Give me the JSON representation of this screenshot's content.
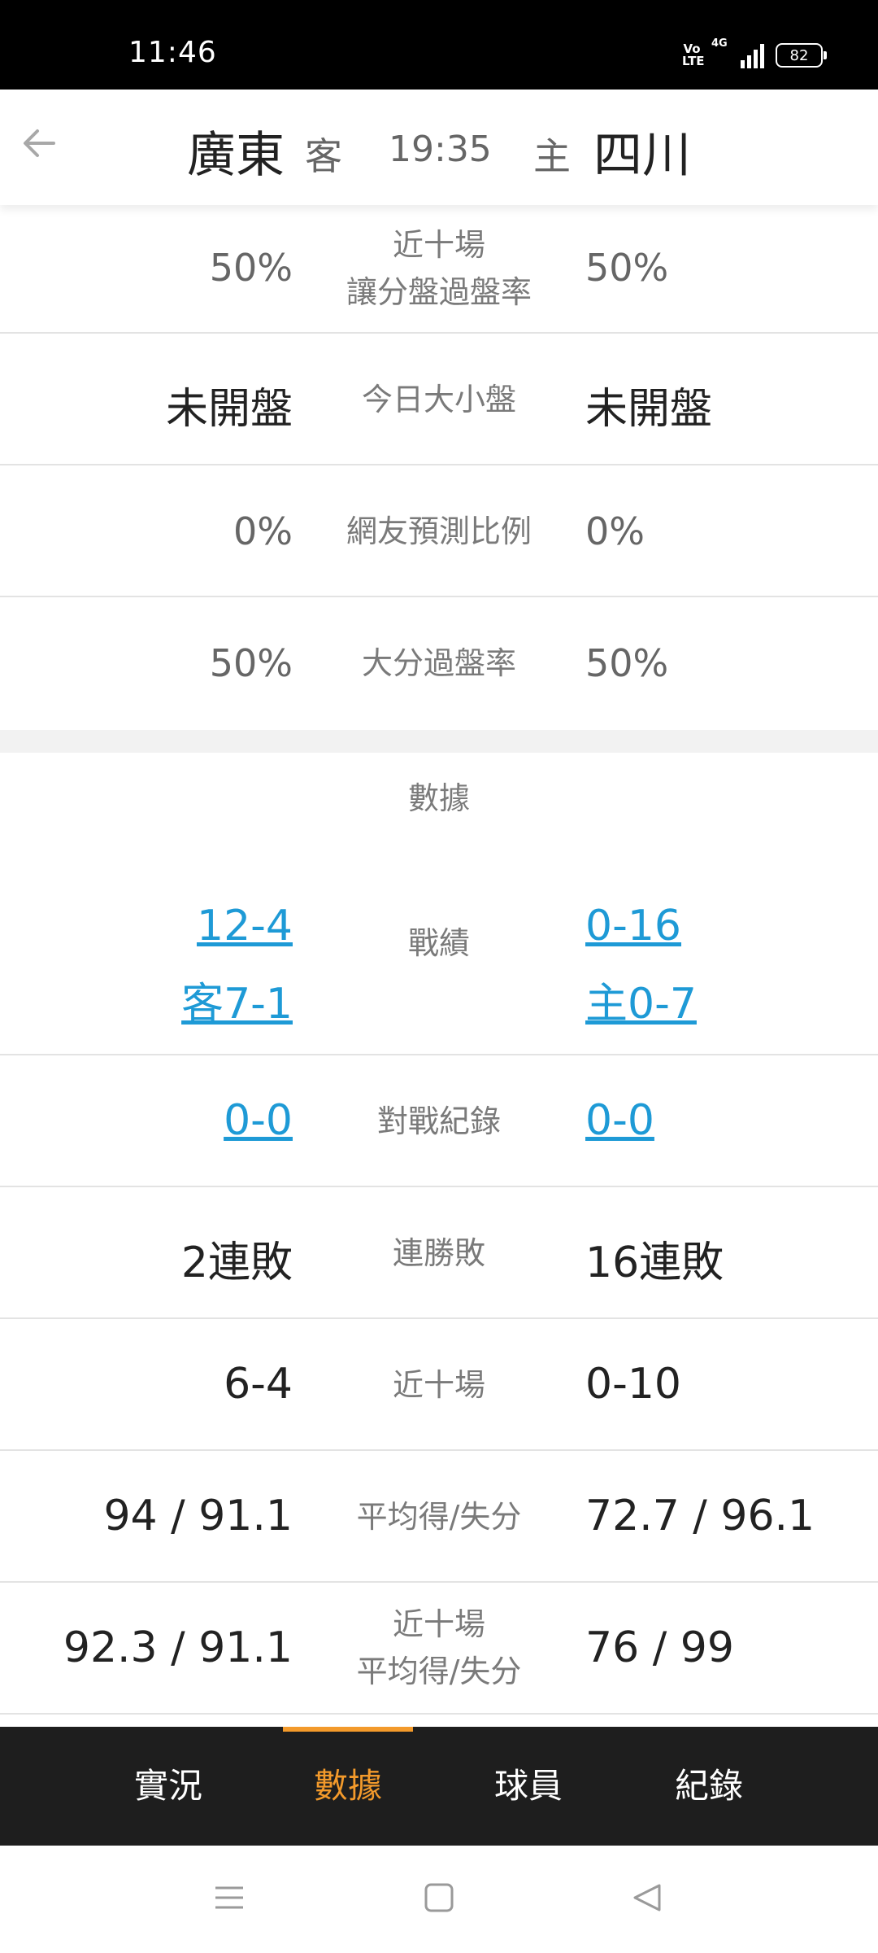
{
  "status_bar": {
    "time": "11:46",
    "volte": "Vo LTE",
    "network": "4G",
    "battery": "82"
  },
  "header": {
    "away_team": "廣東",
    "away_role": "客",
    "time": "19:35",
    "home_role": "主",
    "home_team": "四川"
  },
  "rows": [
    {
      "left": "50%",
      "label_line1": "近十場",
      "label_line2": "讓分盤過盤率",
      "right": "50%"
    },
    {
      "left": "未開盤",
      "label": "今日大小盤",
      "right": "未開盤"
    },
    {
      "left": "0%",
      "label": "網友預測比例",
      "right": "0%"
    },
    {
      "left": "50%",
      "label": "大分過盤率",
      "right": "50%"
    }
  ],
  "data_section": {
    "title": "數據",
    "record": {
      "label": "戰績",
      "left_overall": "12-4",
      "left_split": "客7-1",
      "right_overall": "0-16",
      "right_split": "主0-7"
    },
    "head_to_head": {
      "label": "對戰紀錄",
      "left": "0-0",
      "right": "0-0"
    },
    "streak": {
      "label": "連勝敗",
      "left": "2連敗",
      "right": "16連敗"
    },
    "last_ten": {
      "label": "近十場",
      "left": "6-4",
      "right": "0-10"
    },
    "avg_points": {
      "label": "平均得/失分",
      "left": "94 / 91.1",
      "right": "72.7 / 96.1"
    },
    "last_ten_avg": {
      "label_line1": "近十場",
      "label_line2": "平均得/失分",
      "left": "92.3 / 91.1",
      "right": "76 / 99"
    }
  },
  "tabs": [
    {
      "label": "實況",
      "active": false
    },
    {
      "label": "數據",
      "active": true
    },
    {
      "label": "球員",
      "active": false
    },
    {
      "label": "紀錄",
      "active": false
    }
  ],
  "colors": {
    "accent": "#f39a2b",
    "link": "#1e9ad6",
    "tabbar_bg": "#1e1e1e"
  }
}
